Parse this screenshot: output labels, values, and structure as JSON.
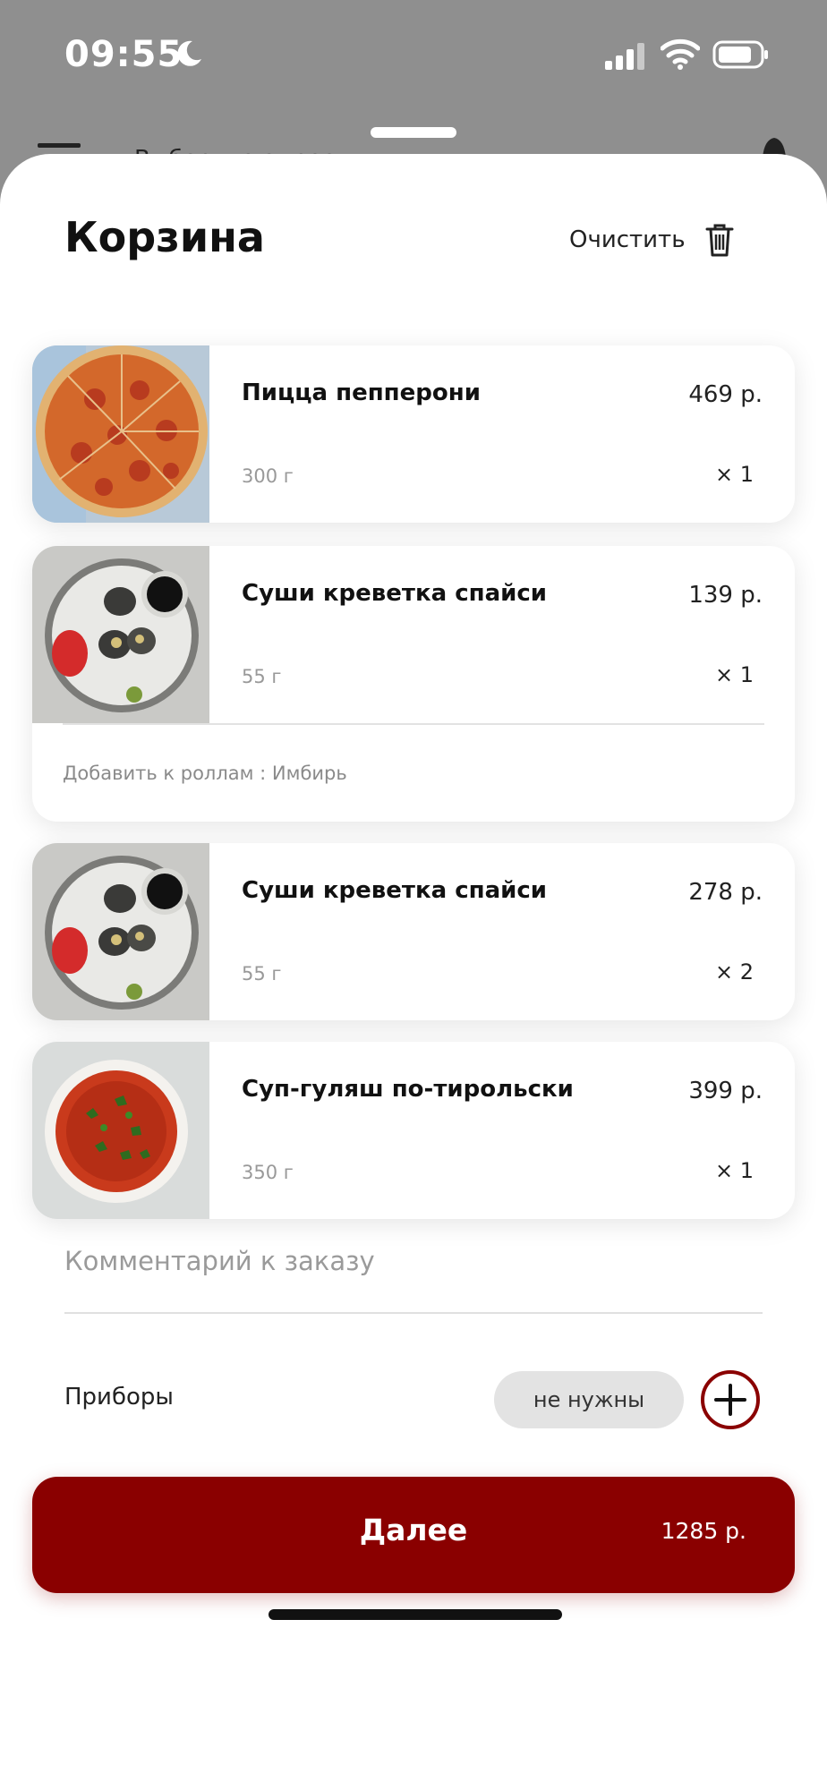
{
  "status_bar": {
    "time": "09:55"
  },
  "background_app": {
    "address_text": "Выберите адрес"
  },
  "cart": {
    "title": "Корзина",
    "clear_label": "Очистить",
    "items": [
      {
        "name": "Пицца пепперони",
        "price": "469 р.",
        "weight": "300 г",
        "qty": "× 1",
        "image": "pizza-image"
      },
      {
        "name": "Суши креветка спайси",
        "price": "139 р.",
        "weight": "55 г",
        "qty": "× 1",
        "note": "Добавить к роллам : Имбирь",
        "image": "sushi-image"
      },
      {
        "name": "Суши креветка спайси",
        "price": "278 р.",
        "weight": "55 г",
        "qty": "× 2",
        "image": "sushi-image"
      },
      {
        "name": "Суп-гуляш по-тирольски",
        "price": "399 р.",
        "weight": "350 г",
        "qty": "× 1",
        "image": "soup-image"
      }
    ],
    "comment_placeholder": "Комментарий к заказу",
    "cutlery_label": "Приборы",
    "cutlery_value": "не нужны",
    "next_label": "Далее",
    "total": "1285 р."
  },
  "colors": {
    "accent": "#8a0000",
    "background_dim": "#8f8f8f",
    "muted_text": "#999999"
  },
  "icons": [
    "moon-icon",
    "cellular-signal-icon",
    "wifi-icon",
    "battery-icon",
    "menu-icon",
    "bell-icon",
    "trash-icon",
    "plus-circle-icon"
  ]
}
